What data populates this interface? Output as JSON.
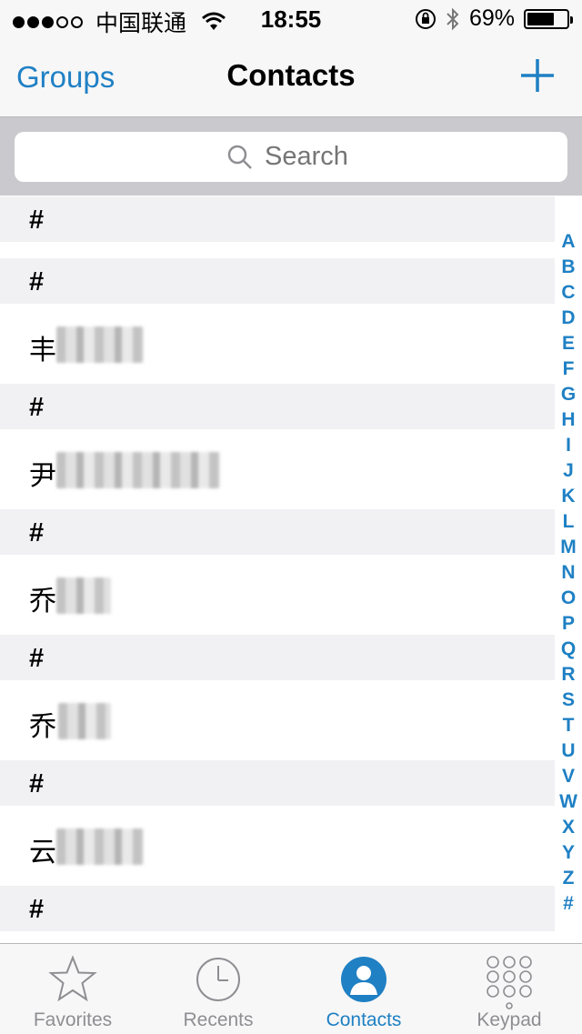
{
  "status_bar": {
    "carrier": "中国联通",
    "time": "18:55",
    "battery_pct_label": "69%",
    "battery_level": 0.69,
    "signal_bars_filled": 3,
    "signal_bars_total": 5
  },
  "nav": {
    "left_label": "Groups",
    "title": "Contacts",
    "add_icon": "plus-icon"
  },
  "search": {
    "placeholder": "Search",
    "icon": "search-icon"
  },
  "list": {
    "headers": [
      "#",
      "#",
      "#",
      "#",
      "#",
      "#",
      "#"
    ],
    "rows": [
      {
        "name_visible": "丰"
      },
      {
        "name_visible": "尹"
      },
      {
        "name_visible": "乔"
      },
      {
        "name_visible": "乔"
      },
      {
        "name_visible": "云"
      }
    ]
  },
  "index": {
    "letters": [
      "A",
      "B",
      "C",
      "D",
      "E",
      "F",
      "G",
      "H",
      "I",
      "J",
      "K",
      "L",
      "M",
      "N",
      "O",
      "P",
      "Q",
      "R",
      "S",
      "T",
      "U",
      "V",
      "W",
      "X",
      "Y",
      "Z",
      "#"
    ]
  },
  "tabs": [
    {
      "label": "Favorites",
      "icon": "star-icon",
      "active": false
    },
    {
      "label": "Recents",
      "icon": "clock-icon",
      "active": false
    },
    {
      "label": "Contacts",
      "icon": "person-icon",
      "active": true
    },
    {
      "label": "Keypad",
      "icon": "keypad-icon",
      "active": false
    }
  ],
  "colors": {
    "accent": "#1f80c4",
    "section_bg": "#f1f1f3",
    "search_bg": "#c9c9ce"
  }
}
